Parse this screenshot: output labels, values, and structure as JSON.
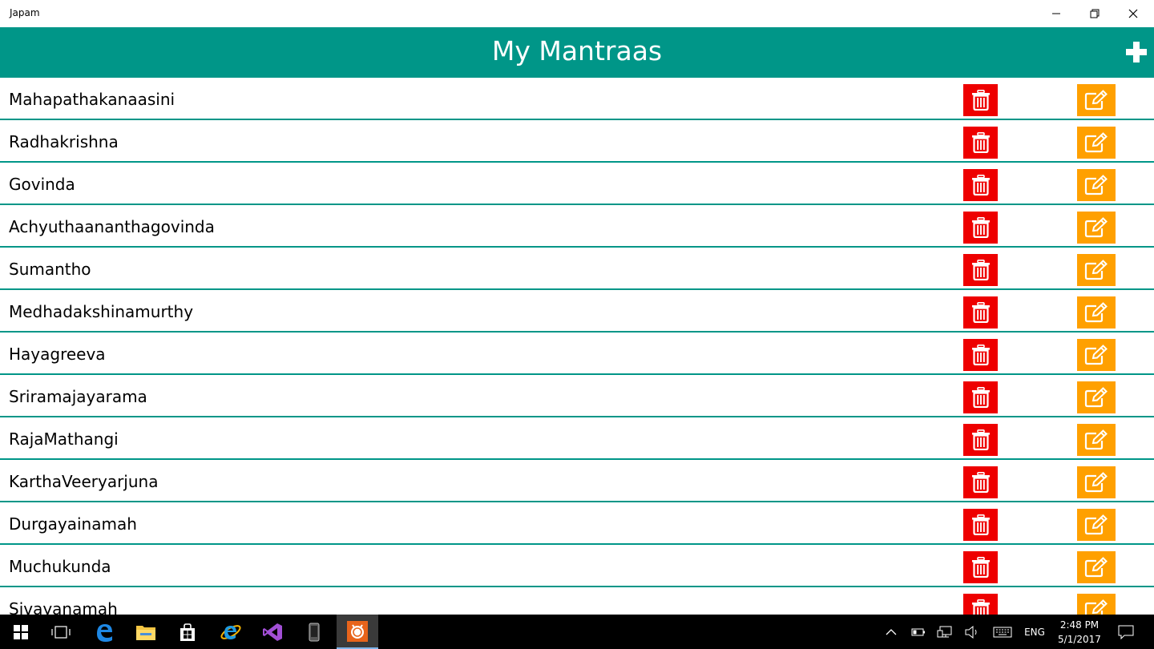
{
  "window": {
    "title": "Japam"
  },
  "header": {
    "title": "My Mantraas",
    "add_icon": "plus-icon"
  },
  "colors": {
    "header_bg": "#009688",
    "delete_bg": "#ee0000",
    "edit_bg": "#ffa000",
    "divider": "#009688"
  },
  "mantras": [
    {
      "name": "Mahapathakanaasini"
    },
    {
      "name": "Radhakrishna"
    },
    {
      "name": "Govinda"
    },
    {
      "name": "Achyuthaananthagovinda"
    },
    {
      "name": "Sumantho"
    },
    {
      "name": "Medhadakshinamurthy"
    },
    {
      "name": "Hayagreeva"
    },
    {
      "name": "Sriramajayarama"
    },
    {
      "name": "RajaMathangi"
    },
    {
      "name": "KarthaVeeryarjuna"
    },
    {
      "name": "Durgayainamah"
    },
    {
      "name": "Muchukunda"
    },
    {
      "name": "Sivayanamah"
    }
  ],
  "taskbar": {
    "apps": [
      "windows-start-icon",
      "task-view-icon",
      "edge-icon",
      "file-explorer-icon",
      "store-icon",
      "internet-explorer-icon",
      "visual-studio-icon",
      "phone-emulator-icon",
      "japam-app-icon"
    ],
    "language": "ENG",
    "time": "2:48 PM",
    "date": "5/1/2017"
  }
}
